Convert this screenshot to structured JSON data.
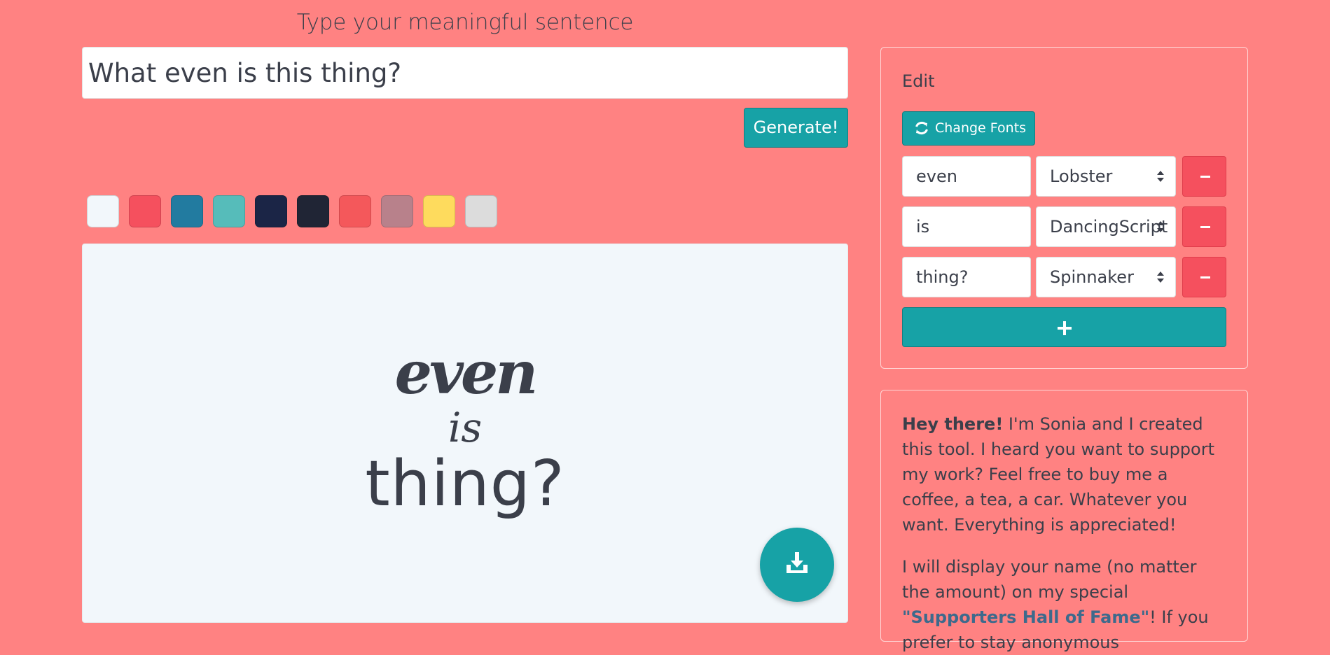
{
  "heading": "Type your meaningful sentence",
  "sentence_value": "What even is this thing?",
  "generate_label": "Generate!",
  "swatches": [
    "#f2f7fb",
    "#f5505e",
    "#227ba0",
    "#56bcba",
    "#1b2546",
    "#202535",
    "#f4585b",
    "#b8818b",
    "#fedb5d",
    "#dcdcdc"
  ],
  "preview": {
    "words": [
      "even",
      "is",
      "thing?"
    ],
    "text_color": "#3b3f4a",
    "background": "#f2f7fb"
  },
  "edit": {
    "title": "Edit",
    "change_fonts_label": "Change Fonts",
    "rows": [
      {
        "word": "even",
        "font": "Lobster"
      },
      {
        "word": "is",
        "font": "DancingScript"
      },
      {
        "word": "thing?",
        "font": "Spinnaker"
      }
    ],
    "add_label": "+"
  },
  "support": {
    "greeting": "Hey there!",
    "p1": " I'm Sonia and I created this tool. I heard you want to support my work? Feel free to buy me a coffee, a tea, a car. Whatever you want. Everything is appreciated!",
    "p2_before": "I will display your name (no matter the amount) on my special ",
    "p2_link": "\"Supporters Hall of Fame\"",
    "p2_after": "! If you prefer to stay anonymous"
  },
  "colors": {
    "page_bg": "#ff8282",
    "accent": "#17a2a6",
    "danger": "#f5505e"
  }
}
